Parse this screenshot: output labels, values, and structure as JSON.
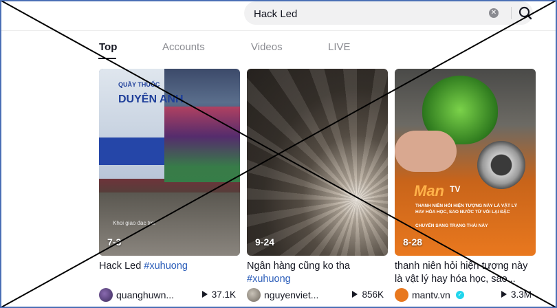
{
  "search": {
    "value": "Hack Led"
  },
  "tabs": [
    {
      "label": "Top",
      "active": true
    },
    {
      "label": "Accounts",
      "active": false
    },
    {
      "label": "Videos",
      "active": false
    },
    {
      "label": "LIVE",
      "active": false
    }
  ],
  "videos": [
    {
      "date": "7-3",
      "title": "Hack Led",
      "hashtag": "#xuhuong",
      "username": "quanghuwn...",
      "plays": "37.1K",
      "thumb_text": [
        "QUẦY THUỐC",
        "DUYÊN ANH",
        "Khoi giao đac troi"
      ]
    },
    {
      "date": "9-24",
      "title": "Ngân hàng cũng ko tha",
      "hashtag": "#xuhuong",
      "username": "nguyenviet...",
      "plays": "856K"
    },
    {
      "date": "8-28",
      "title": "thanh niên hỏi hiện tượng này là vật lý hay hóa học, sao...",
      "username": "mantv.vn",
      "verified": true,
      "plays": "3.3M",
      "thumb_text": [
        "Man",
        "TV",
        "THANH NIÊN HỎI HIỆN TƯỢNG NÀY LÀ VẬT LÝ HAY HÓA HỌC, SAO NƯỚC TỪ VÒI LẠI ĐẶC",
        "CHUYỂN SANG TRẠNG THÁI NÀY"
      ]
    }
  ],
  "colors": {
    "accent_text": "#161823",
    "hashtag": "#2b5db9",
    "cross": "#000000",
    "frame": "#4a6fb5"
  }
}
